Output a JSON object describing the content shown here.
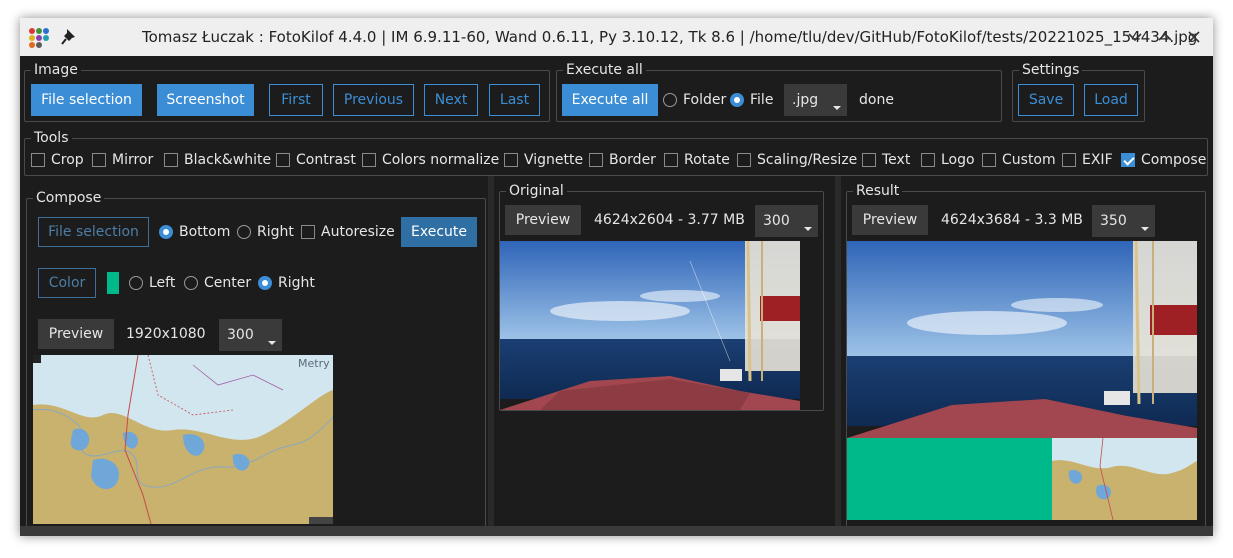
{
  "window": {
    "title": "Tomasz Łuczak : FotoKilof 4.4.0 | IM 6.9.11-60, Wand 0.6.11, Py 3.10.12, Tk 8.6 | /home/tlu/dev/GitHub/FotoKilof/tests/20221025_154434.jpg",
    "controls": [
      "minimize-icon",
      "maximize-icon",
      "close-icon"
    ]
  },
  "image_group": {
    "legend": "Image",
    "buttons": [
      "File selection",
      "Screenshot",
      "First",
      "Previous",
      "Next",
      "Last"
    ]
  },
  "execute_all_group": {
    "legend": "Execute all",
    "button": "Execute all",
    "radio_folder": "Folder",
    "radio_file": "File",
    "selected": "File",
    "format": ".jpg",
    "status": "done"
  },
  "settings_group": {
    "legend": "Settings",
    "save": "Save",
    "load": "Load"
  },
  "tools_group": {
    "legend": "Tools",
    "items": [
      {
        "label": "Crop",
        "checked": false
      },
      {
        "label": "Mirror",
        "checked": false
      },
      {
        "label": "Black&white",
        "checked": false
      },
      {
        "label": "Contrast",
        "checked": false
      },
      {
        "label": "Colors normalize",
        "checked": false
      },
      {
        "label": "Vignette",
        "checked": false
      },
      {
        "label": "Border",
        "checked": false
      },
      {
        "label": "Rotate",
        "checked": false
      },
      {
        "label": "Scaling/Resize",
        "checked": false
      },
      {
        "label": "Text",
        "checked": false
      },
      {
        "label": "Logo",
        "checked": false
      },
      {
        "label": "Custom",
        "checked": false
      },
      {
        "label": "EXIF",
        "checked": false
      },
      {
        "label": "Compose",
        "checked": true
      }
    ]
  },
  "compose": {
    "legend": "Compose",
    "file_selection": "File selection",
    "radio_bottom": "Bottom",
    "radio_right": "Right",
    "position_selected": "Bottom",
    "autoresize": "Autoresize",
    "autoresize_checked": false,
    "execute": "Execute",
    "color_button": "Color",
    "color_value": "#00b98a",
    "align_left": "Left",
    "align_center": "Center",
    "align_right": "Right",
    "align_selected": "Right",
    "preview_button": "Preview",
    "dimensions": "1920x1080",
    "preview_size": "300",
    "map_label": "Metry"
  },
  "original": {
    "legend": "Original",
    "preview_button": "Preview",
    "info": "4624x2604 - 3.77 MB",
    "preview_size": "300"
  },
  "result": {
    "legend": "Result",
    "preview_button": "Preview",
    "info": "4624x3684 - 3.3 MB",
    "preview_size": "350"
  },
  "colors": {
    "accent": "#3b8ed6",
    "background": "#1c1c1c",
    "compose_color": "#00b98a"
  }
}
